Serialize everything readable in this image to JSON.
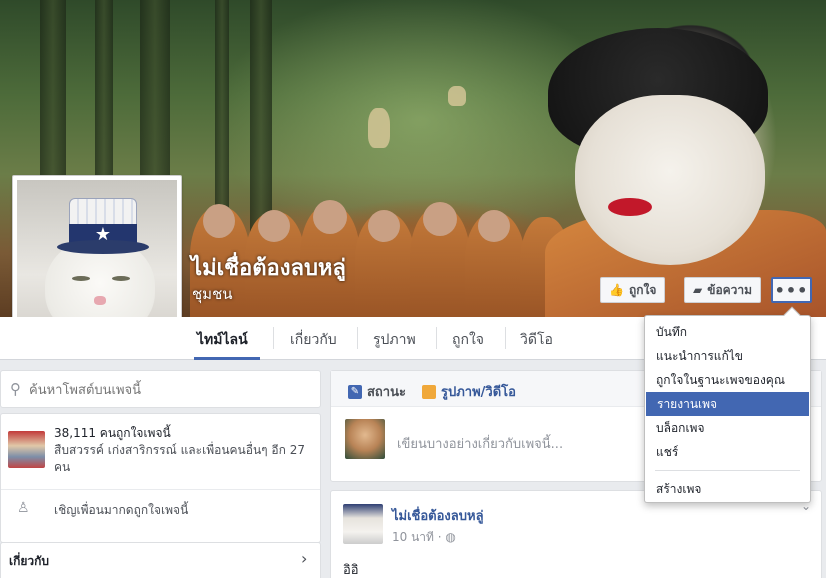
{
  "page": {
    "name": "ไม่เชื่อต้องลบหลู่",
    "category": "ชุมชน"
  },
  "cover_actions": {
    "like_label": "ถูกใจ",
    "message_label": "ข้อความ",
    "more_label": "•••"
  },
  "nav": {
    "tabs": [
      {
        "label": "ไทม์ไลน์",
        "active": true
      },
      {
        "label": "เกี่ยวกับ"
      },
      {
        "label": "รูปภาพ"
      },
      {
        "label": "ถูกใจ"
      },
      {
        "label": "วิดีโอ"
      }
    ]
  },
  "dropdown": {
    "items": [
      {
        "label": "บันทึก"
      },
      {
        "label": "แนะนำการแก้ไข"
      },
      {
        "label": "ถูกใจในฐานะเพจของคุณ"
      },
      {
        "label": "รายงานเพจ",
        "highlighted": true
      },
      {
        "label": "บล็อกเพจ"
      },
      {
        "label": "แชร์"
      },
      {
        "label": "สร้างเพจ"
      }
    ]
  },
  "sidebar": {
    "search_placeholder": "ค้นหาโพสต์บนเพจนี้",
    "likes_count": "38,111 คนถูกใจเพจนี้",
    "likes_friends": "สืบสวรรค์ เก่งสาริกรรณ์ และเพื่อนคนอื่นๆ อีก 27 คน",
    "invite_label": "เชิญเพื่อนมากดถูกใจเพจนี้",
    "about_title": "เกี่ยวกับ"
  },
  "composer": {
    "status_tab": "สถานะ",
    "photo_tab": "รูปภาพ/วิดีโอ",
    "placeholder": "เขียนบางอย่างเกี่ยวกับเพจนี้..."
  },
  "post": {
    "author": "ไม่เชื่อต้องลบหลู่",
    "time": "10 นาที ·",
    "text": "อิอิ"
  },
  "colors": {
    "brand": "#4267b2",
    "link": "#365899",
    "background": "#e9ebee"
  }
}
